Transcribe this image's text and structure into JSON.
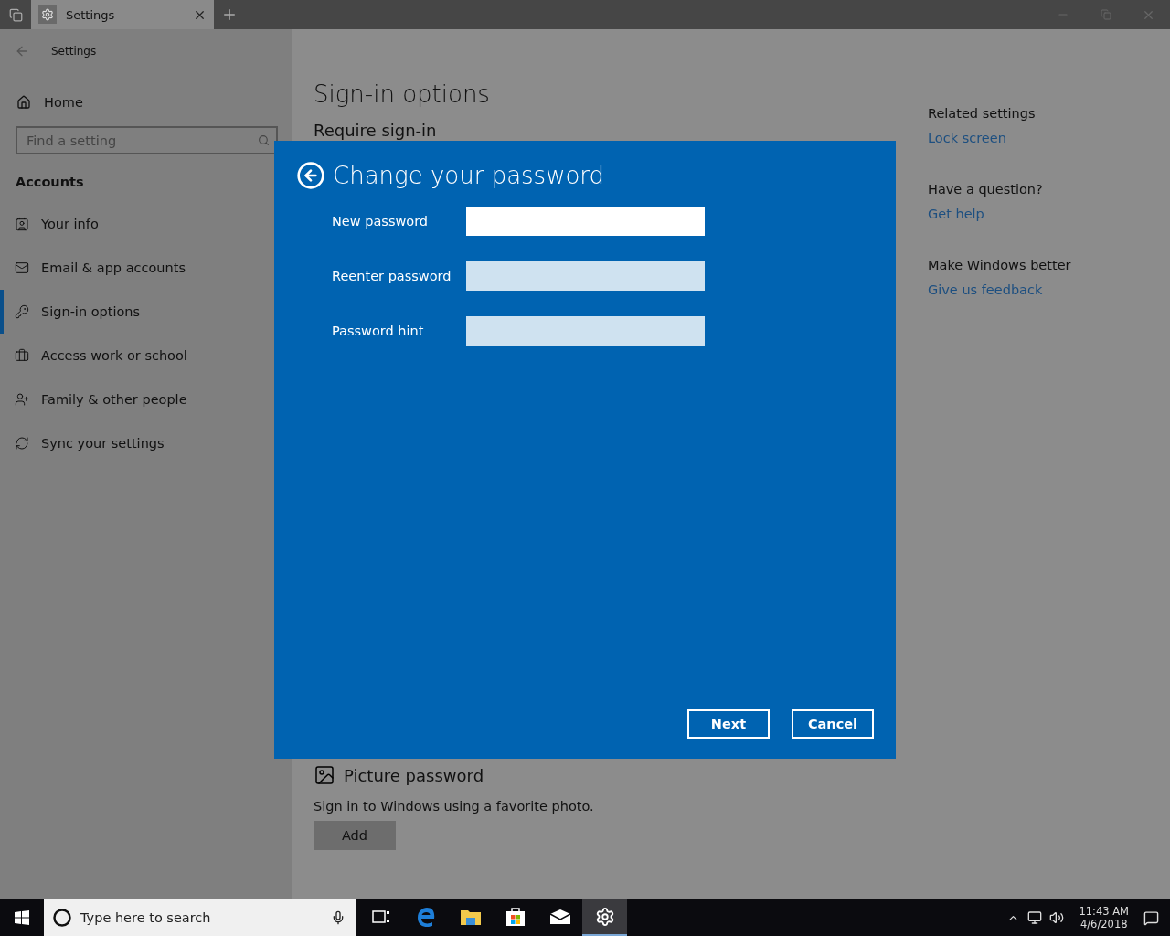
{
  "title_bar": {
    "tab": {
      "label": "Settings",
      "selected": true
    }
  },
  "sidebar": {
    "header": "Settings",
    "home": "Home",
    "search": {
      "placeholder": "Find a setting"
    },
    "section": "Accounts",
    "items": [
      {
        "label": "Your info",
        "selected": false
      },
      {
        "label": "Email & app accounts",
        "selected": false
      },
      {
        "label": "Sign-in options",
        "selected": true
      },
      {
        "label": "Access work or school",
        "selected": false
      },
      {
        "label": "Family & other people",
        "selected": false
      },
      {
        "label": "Sync your settings",
        "selected": false
      }
    ]
  },
  "main": {
    "title": "Sign-in options",
    "subtitle": "Require sign-in",
    "picture_password": {
      "heading": "Picture password",
      "description": "Sign in to Windows using a favorite photo.",
      "button": "Add"
    }
  },
  "related": [
    {
      "heading": "Related settings",
      "link": "Lock screen"
    },
    {
      "heading": "Have a question?",
      "link": "Get help"
    },
    {
      "heading": "Make Windows better",
      "link": "Give us feedback"
    }
  ],
  "dialog": {
    "title": "Change your password",
    "fields": [
      {
        "label": "New password",
        "focused": true
      },
      {
        "label": "Reenter password",
        "focused": false
      },
      {
        "label": "Password hint",
        "focused": false
      }
    ],
    "buttons": [
      "Next",
      "Cancel"
    ]
  },
  "taskbar": {
    "search": {
      "placeholder": "Type here to search"
    },
    "apps": [
      {
        "kind": "taskview",
        "selected": false
      },
      {
        "kind": "edge",
        "selected": false
      },
      {
        "kind": "explorer",
        "selected": false
      },
      {
        "kind": "store",
        "selected": false
      },
      {
        "kind": "mail",
        "selected": false
      },
      {
        "kind": "settings",
        "selected": true
      }
    ],
    "time": "11:43 AM",
    "date": "4/6/2018"
  }
}
